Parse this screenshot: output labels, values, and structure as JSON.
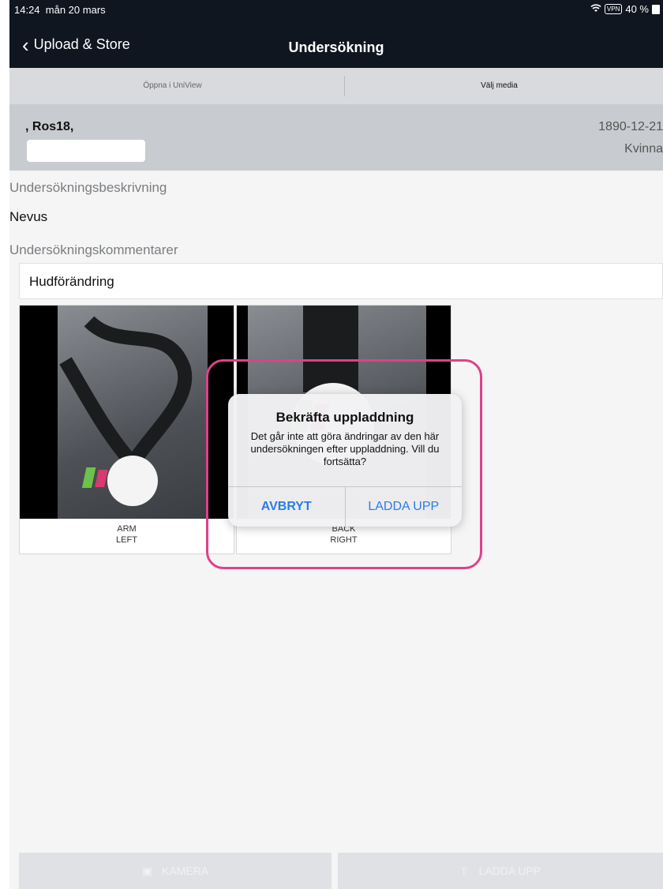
{
  "status": {
    "time": "14:24",
    "date": "mån 20 mars",
    "vpn": "VPN",
    "battery": "40 %"
  },
  "nav": {
    "back_label": "Upload & Store",
    "title": "Undersökning"
  },
  "segments": [
    "Öppna i UniView",
    "Välj media"
  ],
  "patient": {
    "name": ", Ros18,",
    "birthdate": "1890-12-21",
    "sex": "Kvinna"
  },
  "form": {
    "description_label": "Undersökningsbeskrivning",
    "description_value": "Nevus",
    "comments_label": "Undersökningskommentarer",
    "comments_value": "Hudförändring"
  },
  "images": [
    {
      "line1": "ARM",
      "line2": "LEFT"
    },
    {
      "line1": "BACK",
      "line2": "RIGHT"
    }
  ],
  "alert": {
    "title": "Bekräfta uppladdning",
    "message": "Det går inte att göra ändringar av den här undersökningen efter uppladdning. Vill du fortsätta?",
    "cancel": "AVBRYT",
    "confirm": "LADDA UPP"
  },
  "bottom": {
    "camera": "KAMERA",
    "upload": "LADDA UPP"
  },
  "colors": {
    "accent": "#2b7de9",
    "highlight": "#e0408a",
    "navbar": "#0f1620"
  }
}
